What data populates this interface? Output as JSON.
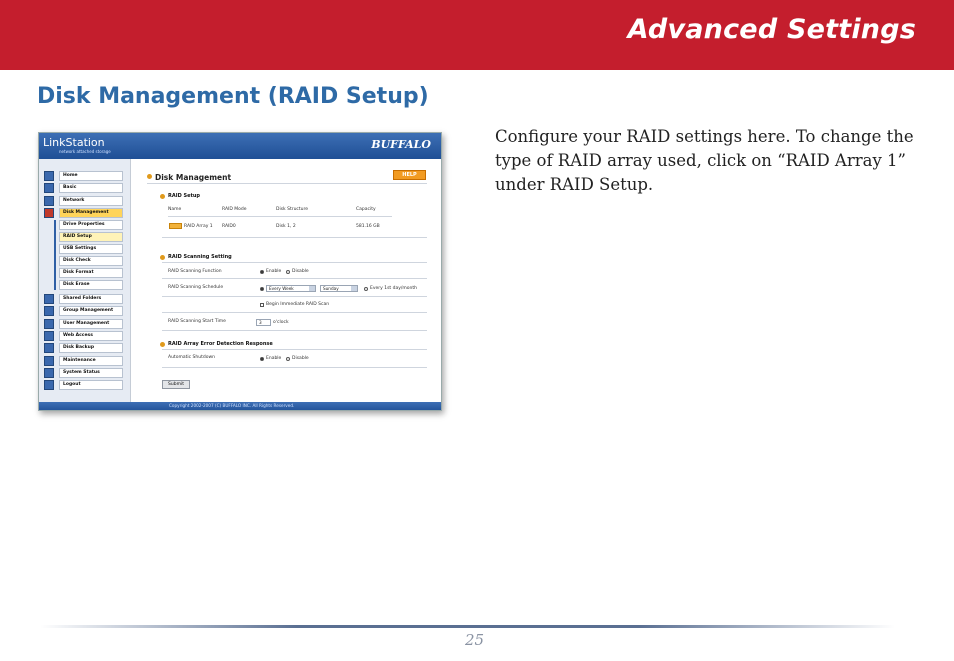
{
  "header": {
    "title": "Advanced Settings",
    "color": "#c41e2d"
  },
  "section": {
    "title": "Disk Management (RAID Setup)",
    "color": "#2e6aa6"
  },
  "description": "Configure your RAID settings here.  To change the type of RAID array used, click on “RAID Array 1” under RAID Setup.",
  "screenshot": {
    "logo": "LinkStation",
    "logo_sub": "network attached storage",
    "brand": "BUFFALO",
    "nav": [
      {
        "label": "Home"
      },
      {
        "label": "Basic"
      },
      {
        "label": "Network"
      },
      {
        "label": "Disk Management"
      },
      {
        "label": "Drive Properties"
      },
      {
        "label": "RAID Setup"
      },
      {
        "label": "USB Settings"
      },
      {
        "label": "Disk Check"
      },
      {
        "label": "Disk Format"
      },
      {
        "label": "Disk Erase"
      },
      {
        "label": "Shared Folders"
      },
      {
        "label": "Group Management"
      },
      {
        "label": "User Management"
      },
      {
        "label": "Web Access"
      },
      {
        "label": "Disk Backup"
      },
      {
        "label": "Maintenance"
      },
      {
        "label": "System Status"
      },
      {
        "label": "Logout"
      }
    ],
    "page_title": "Disk Management",
    "help": "HELP",
    "raid_setup": {
      "title": "RAID Setup",
      "headers": [
        "Name",
        "RAID Mode",
        "Disk Structure",
        "Capacity"
      ],
      "row": [
        "RAID Array 1",
        "RAID0",
        "Disk 1, 2",
        "581.16 GB"
      ]
    },
    "scanning": {
      "title": "RAID Scanning Setting",
      "function_label": "RAID Scanning Function",
      "enable": "Enable",
      "disable": "Disable",
      "schedule_label": "RAID Scanning Schedule",
      "schedule_freq": "Every Week",
      "schedule_day": "Sunday",
      "schedule_alt": "Every 1st day/month",
      "begin_label": "Begin Immediate RAID Scan",
      "start_label": "RAID Scanning Start Time",
      "start_value": "3",
      "start_unit": "o'clock"
    },
    "error_response": {
      "title": "RAID Array Error Detection Response",
      "shutdown_label": "Automatic Shutdown",
      "enable": "Enable",
      "disable": "Disable"
    },
    "submit": "Submit",
    "copyright": "Copyright 2002-2007 (C) BUFFALO INC. All Rights Reserved."
  },
  "page_number": "25"
}
